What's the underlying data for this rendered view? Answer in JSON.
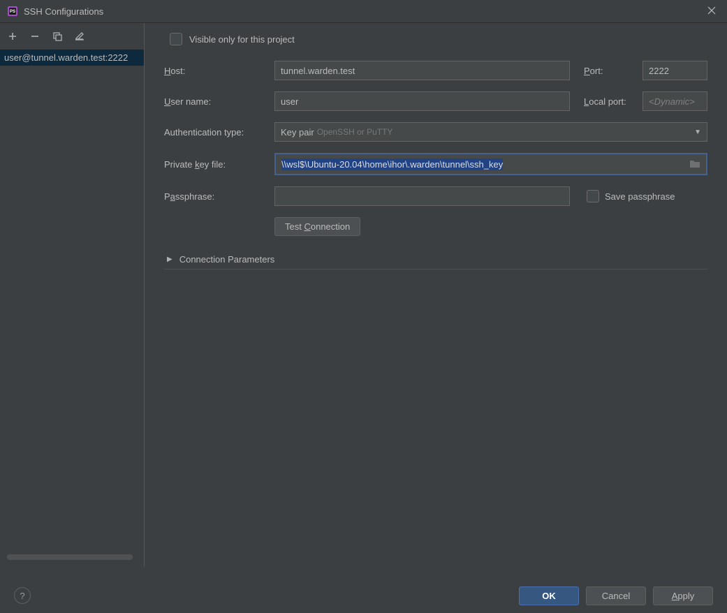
{
  "window": {
    "title": "SSH Configurations",
    "app_icon": "ps-icon"
  },
  "sidebar": {
    "items": [
      {
        "label": "user@tunnel.warden.test:2222",
        "selected": true
      }
    ]
  },
  "form": {
    "visible_only_label": "Visible only for this project",
    "visible_only_checked": false,
    "host_label": "Host:",
    "host_value": "tunnel.warden.test",
    "port_label": "Port:",
    "port_value": "2222",
    "user_label": "User name:",
    "user_value": "user",
    "local_port_label": "Local port:",
    "local_port_placeholder": "<Dynamic>",
    "local_port_value": "",
    "auth_label": "Authentication type:",
    "auth_value": "Key pair",
    "auth_hint": "OpenSSH or PuTTY",
    "pk_label": "Private key file:",
    "pk_value": "\\\\wsl$\\Ubuntu-20.04\\home\\ihor\\.warden\\tunnel\\ssh_key",
    "pass_label": "Passphrase:",
    "pass_value": "",
    "save_pass_label": "Save passphrase",
    "save_pass_checked": false,
    "test_button": "Test Connection",
    "conn_params_label": "Connection Parameters"
  },
  "footer": {
    "ok": "OK",
    "cancel": "Cancel",
    "apply": "Apply"
  }
}
